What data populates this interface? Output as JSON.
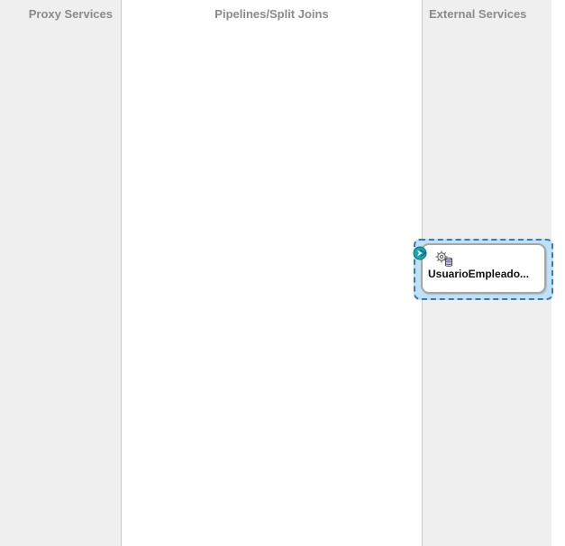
{
  "lanes": {
    "proxy_title": "Proxy Services",
    "pipelines_title": "Pipelines/Split Joins",
    "external_title": "External Services"
  },
  "external_service": {
    "label": "UsuarioEmpleado...",
    "icon": "gear-database-icon",
    "port_icon": "service-port-icon"
  },
  "colors": {
    "lane_background": "#efefef",
    "selection_fill": "#bfe1f4",
    "selection_border": "#3a78c4",
    "port_color": "#1aa6b0"
  }
}
